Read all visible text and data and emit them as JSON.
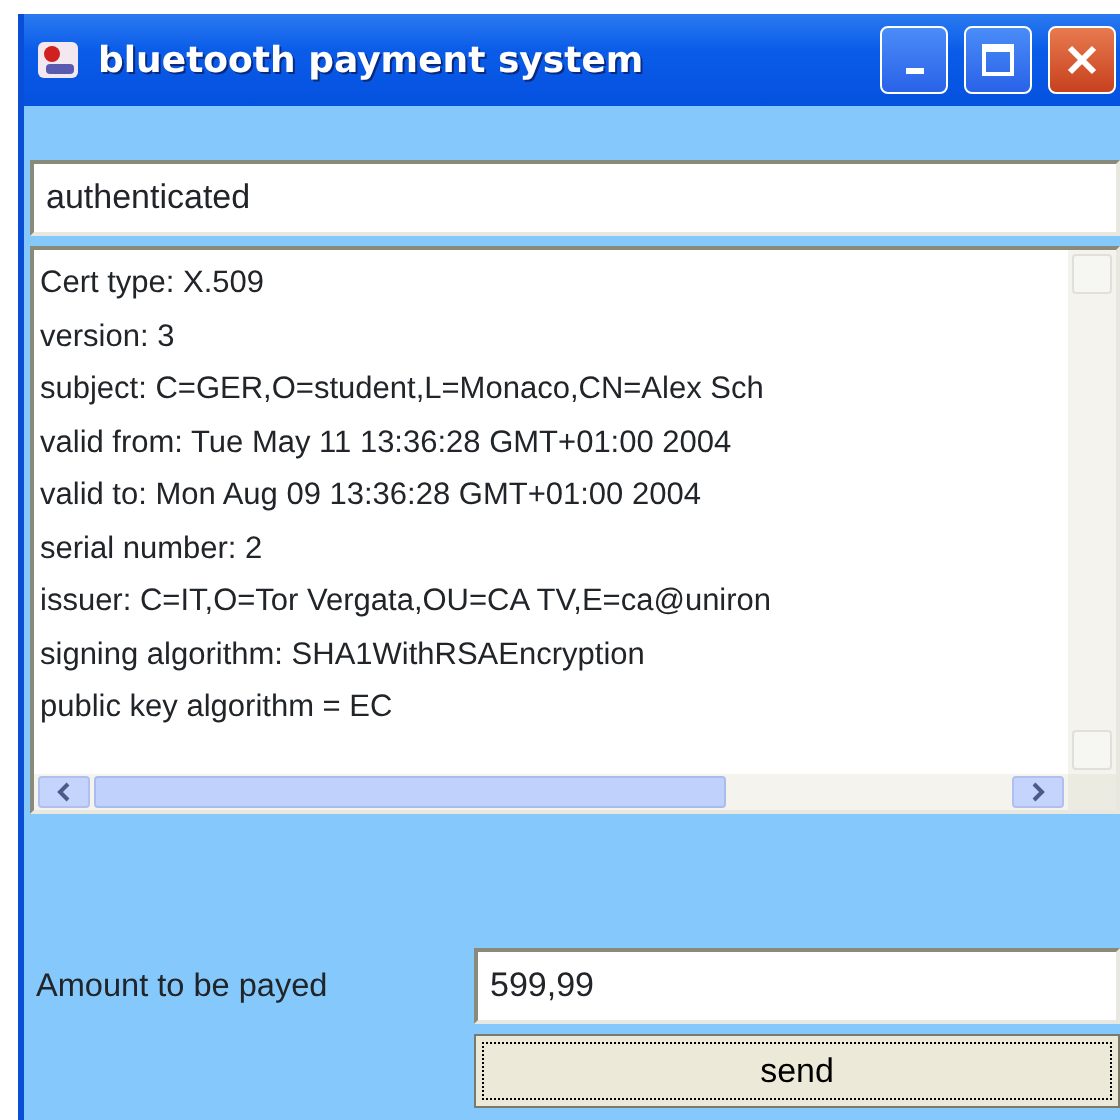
{
  "window": {
    "title": "bluetooth payment system"
  },
  "status_field": {
    "value": "authenticated"
  },
  "certificate_lines": [
    "Cert type: X.509",
    "version: 3",
    "subject: C=GER,O=student,L=Monaco,CN=Alex Sch",
    "valid from: Tue May 11 13:36:28 GMT+01:00 2004",
    "valid to: Mon Aug 09 13:36:28 GMT+01:00 2004",
    "serial number: 2",
    "issuer: C=IT,O=Tor Vergata,OU=CA TV,E=ca@uniron",
    "signing algorithm: SHA1WithRSAEncryption",
    "public key algorithm = EC"
  ],
  "amount": {
    "label": "Amount to be payed",
    "value": "599,99"
  },
  "send_button": {
    "label": "send",
    "focused": true
  }
}
